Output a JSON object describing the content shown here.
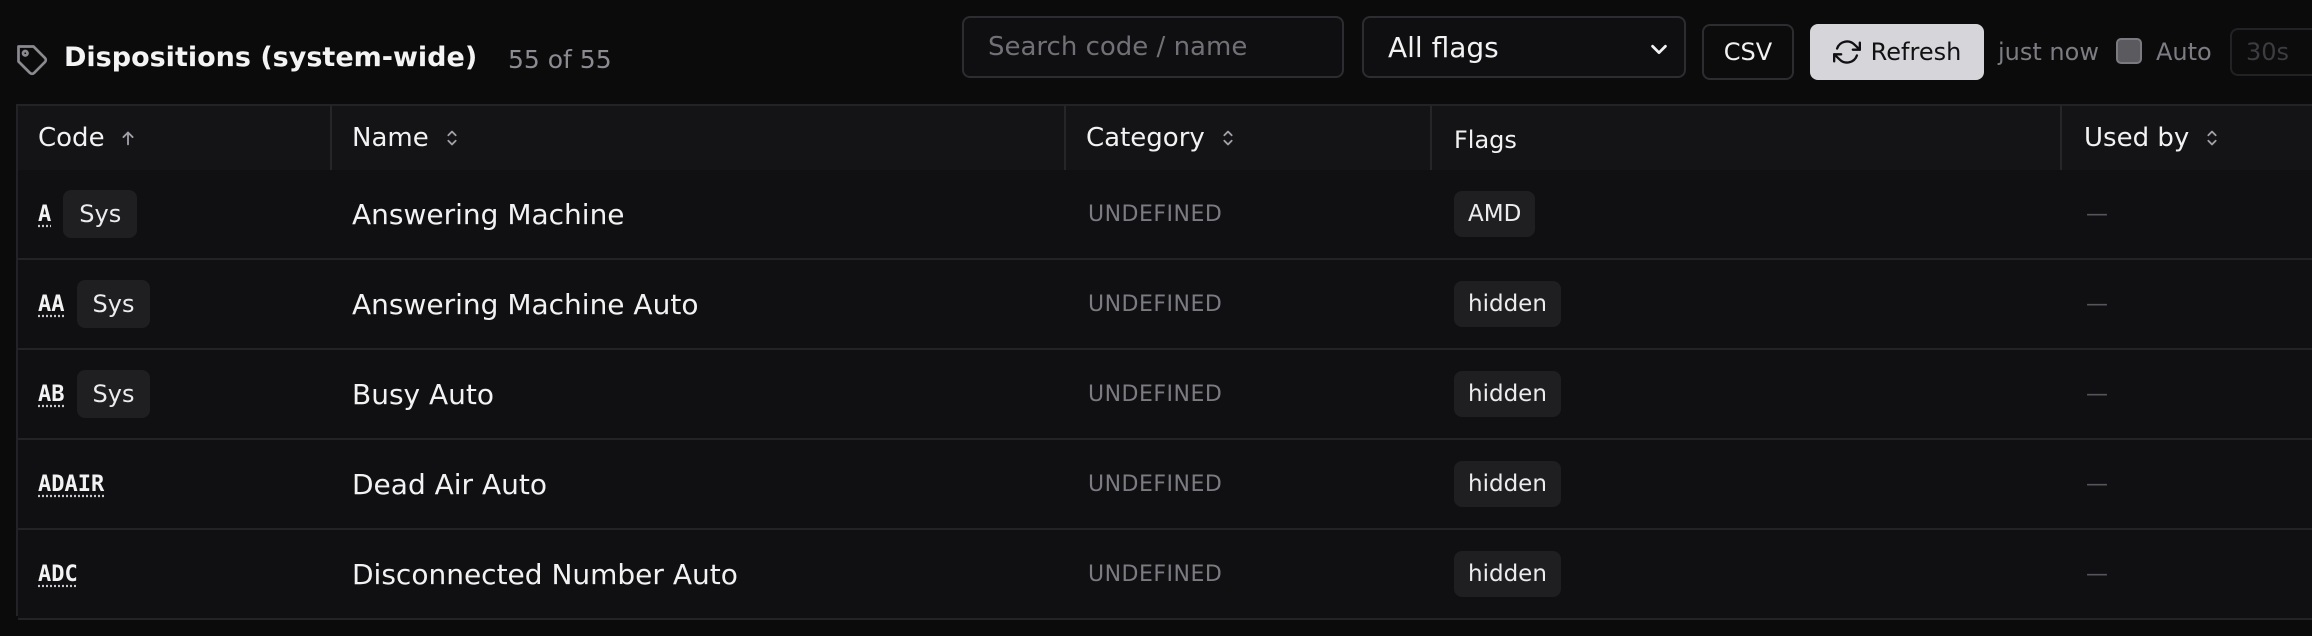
{
  "header": {
    "title": "Dispositions (system-wide)",
    "count": "55 of 55",
    "search_placeholder": "Search code / name",
    "flag_filter": "All flags",
    "csv_label": "CSV",
    "refresh_label": "Refresh",
    "last_updated": "just now",
    "auto_label": "Auto",
    "auto_checked": false,
    "interval": "30s"
  },
  "icons": {
    "title": "tag-icon",
    "refresh": "refresh-icon",
    "dropdown": "chevron-down-icon",
    "sort_active": "arrow-up-icon",
    "sort": "sort-icon"
  },
  "table": {
    "columns": [
      {
        "label": "Code",
        "sort": "asc"
      },
      {
        "label": "Name",
        "sort": "sortable"
      },
      {
        "label": "Category",
        "sort": "sortable"
      },
      {
        "label": "Flags",
        "sort": "none"
      },
      {
        "label": "Used by",
        "sort": "sortable"
      }
    ],
    "rows": [
      {
        "code": "A",
        "sys": "Sys",
        "name": "Answering Machine",
        "category": "UNDEFINED",
        "flag": "AMD",
        "used_by": "—"
      },
      {
        "code": "AA",
        "sys": "Sys",
        "name": "Answering Machine Auto",
        "category": "UNDEFINED",
        "flag": "hidden",
        "used_by": "—"
      },
      {
        "code": "AB",
        "sys": "Sys",
        "name": "Busy Auto",
        "category": "UNDEFINED",
        "flag": "hidden",
        "used_by": "—"
      },
      {
        "code": "ADAIR",
        "sys": "",
        "name": "Dead Air Auto",
        "category": "UNDEFINED",
        "flag": "hidden",
        "used_by": "—"
      },
      {
        "code": "ADC",
        "sys": "",
        "name": "Disconnected Number Auto",
        "category": "UNDEFINED",
        "flag": "hidden",
        "used_by": "—"
      }
    ]
  },
  "colors": {
    "background": "#0b0b0c",
    "header_row": "#141416",
    "row": "#101012",
    "badge": "#1f1f22",
    "refresh_button": "#d6d6da",
    "muted_text": "#7b7b82"
  }
}
